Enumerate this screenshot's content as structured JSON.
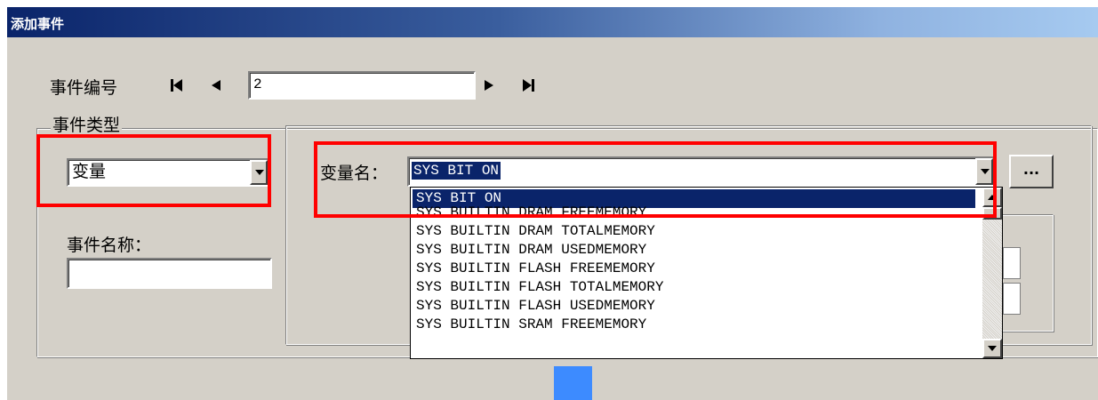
{
  "window": {
    "title": "添加事件"
  },
  "event_number": {
    "label": "事件编号",
    "value": "2",
    "first_button": "first",
    "prev_button": "previous",
    "next_button": "next",
    "last_button": "last"
  },
  "event_type": {
    "group_label": "事件类型",
    "selected": "变量"
  },
  "event_name": {
    "label": "事件名称：",
    "value": ""
  },
  "variable": {
    "label": "变量名：",
    "selected": "SYS BIT ON",
    "browse_label": "...",
    "options": [
      "SYS BIT ON",
      "SYS BUILTIN DRAM FREEMEMORY",
      "SYS BUILTIN DRAM TOTALMEMORY",
      "SYS BUILTIN DRAM USEDMEMORY",
      "SYS BUILTIN FLASH FREEMEMORY",
      "SYS BUILTIN FLASH TOTALMEMORY",
      "SYS BUILTIN FLASH USEDMEMORY",
      "SYS BUILTIN SRAM FREEMEMORY"
    ]
  },
  "colors": {
    "highlight": "#0a246a",
    "annotation": "#ff0000",
    "marker": "#3d8bff"
  }
}
